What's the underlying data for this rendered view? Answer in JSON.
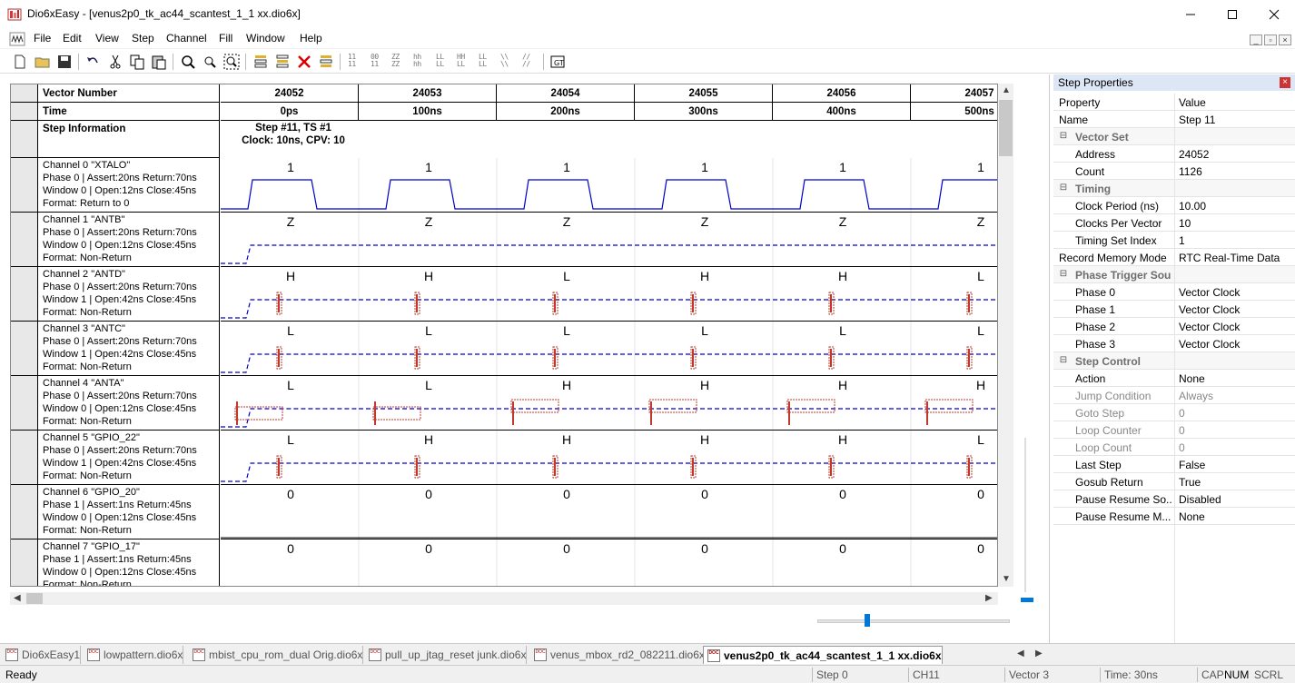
{
  "window": {
    "app_name": "Dio6xEasy",
    "file_name": "[venus2p0_tk_ac44_scantest_1_1 xx.dio6x]"
  },
  "menu": [
    "File",
    "Edit",
    "View",
    "Step",
    "Channel",
    "Fill",
    "Window",
    "Help"
  ],
  "toolbar_text_buttons": [
    "11\n11",
    "00\n11",
    "ZZ\nZZ",
    "hh\nhh",
    "LL\nLL",
    "HH\nLL",
    "LL\nLL",
    "\\\\\n\\\\",
    "//\n//"
  ],
  "grid": {
    "header_vector": "Vector Number",
    "header_time": "Time",
    "step_info_label": "Step Information",
    "step_info_line1": "Step #11, TS #1",
    "step_info_line2": "Clock: 10ns, CPV: 10",
    "vectors": [
      "24052",
      "24053",
      "24054",
      "24055",
      "24056",
      "24057"
    ],
    "times": [
      "0ps",
      "100ns",
      "200ns",
      "300ns",
      "400ns",
      "500ns"
    ],
    "channels": [
      {
        "name": "Channel 0 \"XTALO\"",
        "phase": "Phase 0 | Assert:20ns Return:70ns",
        "window": "Window 0 | Open:12ns Close:45ns",
        "format": "Format: Return to 0",
        "values": [
          "1",
          "1",
          "1",
          "1",
          "1",
          "1"
        ],
        "kind": "clock"
      },
      {
        "name": "Channel 1 \"ANTB\"",
        "phase": "Phase 0 | Assert:20ns Return:70ns",
        "window": "Window 0 | Open:12ns Close:45ns",
        "format": "Format: Non-Return",
        "values": [
          "Z",
          "Z",
          "Z",
          "Z",
          "Z",
          "Z"
        ],
        "kind": "z"
      },
      {
        "name": "Channel 2 \"ANTD\"",
        "phase": "Phase 0 | Assert:20ns Return:70ns",
        "window": "Window 1 | Open:42ns Close:45ns",
        "format": "Format: Non-Return",
        "values": [
          "H",
          "H",
          "L",
          "H",
          "H",
          "L"
        ],
        "kind": "narrow"
      },
      {
        "name": "Channel 3 \"ANTC\"",
        "phase": "Phase 0 | Assert:20ns Return:70ns",
        "window": "Window 1 | Open:42ns Close:45ns",
        "format": "Format: Non-Return",
        "values": [
          "L",
          "L",
          "L",
          "L",
          "L",
          "L"
        ],
        "kind": "narrow"
      },
      {
        "name": "Channel 4 \"ANTA\"",
        "phase": "Phase 0 | Assert:20ns Return:70ns",
        "window": "Window 0 | Open:12ns Close:45ns",
        "format": "Format: Non-Return",
        "values": [
          "L",
          "L",
          "H",
          "H",
          "H",
          "H"
        ],
        "kind": "wide"
      },
      {
        "name": "Channel 5 \"GPIO_22\"",
        "phase": "Phase 0 | Assert:20ns Return:70ns",
        "window": "Window 1 | Open:42ns Close:45ns",
        "format": "Format: Non-Return",
        "values": [
          "L",
          "H",
          "H",
          "H",
          "H",
          "L"
        ],
        "kind": "narrow"
      },
      {
        "name": "Channel 6 \"GPIO_20\"",
        "phase": "Phase 1 | Assert:1ns Return:45ns",
        "window": "Window 0 | Open:12ns Close:45ns",
        "format": "Format: Non-Return",
        "values": [
          "0",
          "0",
          "0",
          "0",
          "0",
          "0"
        ],
        "kind": "flat"
      },
      {
        "name": "Channel 7 \"GPIO_17\"",
        "phase": "Phase 1 | Assert:1ns Return:45ns",
        "window": "Window 0 | Open:12ns Close:45ns",
        "format": "Format: Non-Return",
        "values": [
          "0",
          "0",
          "0",
          "0",
          "0",
          "0"
        ],
        "kind": "flat"
      }
    ]
  },
  "properties": {
    "title": "Step Properties",
    "col_property": "Property",
    "col_value": "Value",
    "rows": [
      {
        "type": "prop",
        "name": "Name",
        "value": "Step 11"
      },
      {
        "type": "cat",
        "name": "Vector Set"
      },
      {
        "type": "prop",
        "name": "Address",
        "value": "24052"
      },
      {
        "type": "prop",
        "name": "Count",
        "value": "1126"
      },
      {
        "type": "cat",
        "name": "Timing"
      },
      {
        "type": "prop",
        "name": "Clock Period (ns)",
        "value": "10.00"
      },
      {
        "type": "prop",
        "name": "Clocks Per Vector",
        "value": "10"
      },
      {
        "type": "prop",
        "name": "Timing Set Index",
        "value": "1"
      },
      {
        "type": "prop",
        "name": "Record Memory Mode",
        "value": "RTC Real-Time Data"
      },
      {
        "type": "cat",
        "name": "Phase Trigger Source"
      },
      {
        "type": "prop",
        "name": "Phase 0",
        "value": "Vector Clock"
      },
      {
        "type": "prop",
        "name": "Phase 1",
        "value": "Vector Clock"
      },
      {
        "type": "prop",
        "name": "Phase 2",
        "value": "Vector Clock"
      },
      {
        "type": "prop",
        "name": "Phase 3",
        "value": "Vector Clock"
      },
      {
        "type": "cat",
        "name": "Step Control"
      },
      {
        "type": "prop",
        "name": "Action",
        "value": "None"
      },
      {
        "type": "dis",
        "name": "Jump Condition",
        "value": "Always"
      },
      {
        "type": "dis",
        "name": "Goto Step",
        "value": "0"
      },
      {
        "type": "dis",
        "name": "Loop Counter",
        "value": "0"
      },
      {
        "type": "dis",
        "name": "Loop Count",
        "value": "0"
      },
      {
        "type": "prop",
        "name": "Last Step",
        "value": "False"
      },
      {
        "type": "prop",
        "name": "Gosub Return",
        "value": "True"
      },
      {
        "type": "prop",
        "name": "Pause Resume So...",
        "value": "Disabled"
      },
      {
        "type": "prop",
        "name": "Pause Resume M...",
        "value": "None"
      }
    ]
  },
  "tabs": [
    {
      "label": "Dio6xEasy1",
      "active": false
    },
    {
      "label": "lowpattern.dio6x",
      "active": false
    },
    {
      "label": "mbist_cpu_rom_dual Orig.dio6x",
      "active": false
    },
    {
      "label": "pull_up_jtag_reset junk.dio6x",
      "active": false
    },
    {
      "label": "venus_mbox_rd2_082211.dio6x",
      "active": false
    },
    {
      "label": "venus2p0_tk_ac44_scantest_1_1 xx.dio6x",
      "active": true
    }
  ],
  "tab_icon_text": "DOC",
  "status": {
    "ready": "Ready",
    "step": "Step 0",
    "channel": "CH11",
    "vector": "Vector 3",
    "time": "Time: 30ns",
    "cap": "CAP",
    "num": "NUM",
    "scrl": "SCRL"
  },
  "colors": {
    "signal_blue": "#0000cc",
    "strobe_red": "#c0392b",
    "header_gray": "#e8e8e8",
    "panel_title": "#dce6f4",
    "accent": "#0078d7"
  }
}
